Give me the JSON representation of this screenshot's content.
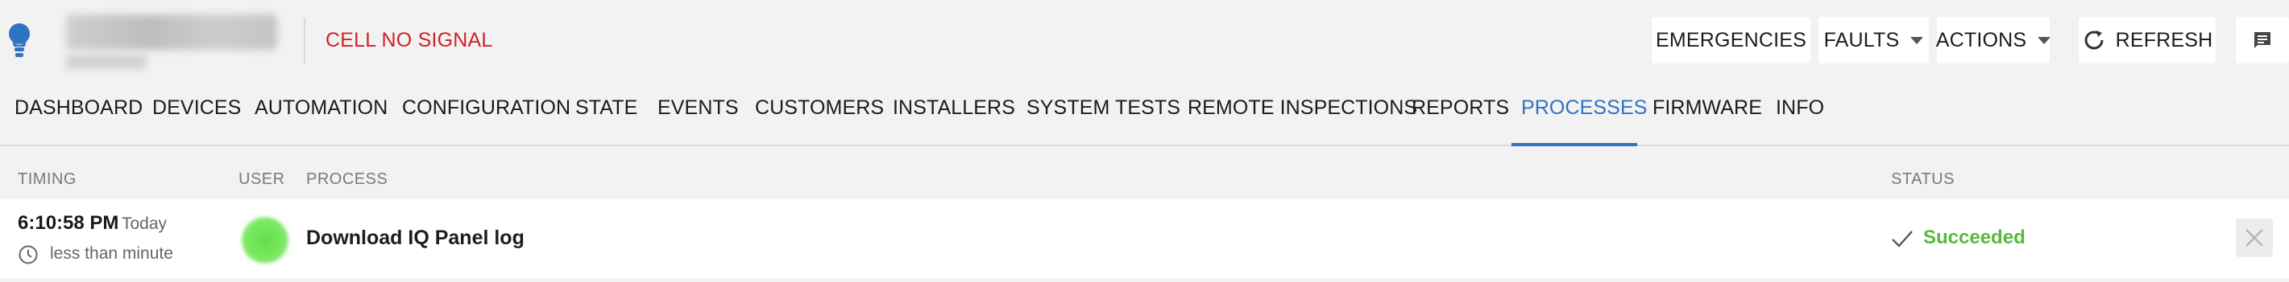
{
  "header": {
    "signal_status": "CELL NO SIGNAL",
    "buttons": {
      "emergencies": "EMERGENCIES",
      "faults": "FAULTS",
      "actions": "ACTIONS",
      "refresh": "REFRESH"
    },
    "icons": {
      "logo": "lightbulb-icon",
      "refresh": "refresh-icon",
      "messages": "message-icon",
      "caret": "chevron-down-icon"
    }
  },
  "nav": {
    "tabs": [
      {
        "label": "DASHBOARD"
      },
      {
        "label": "DEVICES"
      },
      {
        "label": "AUTOMATION"
      },
      {
        "label": "CONFIGURATION"
      },
      {
        "label": "STATE"
      },
      {
        "label": "EVENTS"
      },
      {
        "label": "CUSTOMERS"
      },
      {
        "label": "INSTALLERS"
      },
      {
        "label": "SYSTEM TESTS"
      },
      {
        "label": "REMOTE INSPECTIONS"
      },
      {
        "label": "REPORTS"
      },
      {
        "label": "PROCESSES"
      },
      {
        "label": "FIRMWARE"
      },
      {
        "label": "INFO"
      }
    ],
    "active_tab": "PROCESSES"
  },
  "table": {
    "columns": {
      "timing": "TIMING",
      "user": "USER",
      "process": "PROCESS",
      "status": "STATUS"
    },
    "rows": [
      {
        "time": "6:10:58 PM",
        "day": "Today",
        "duration": "less than minute",
        "process": "Download IQ Panel log",
        "status": "Succeeded"
      }
    ]
  },
  "colors": {
    "accent": "#2f73c3",
    "alert": "#d0202a",
    "success": "#57b93a"
  }
}
